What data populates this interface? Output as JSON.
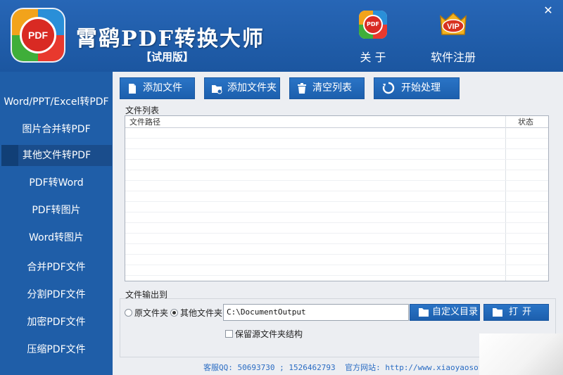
{
  "header": {
    "logo_text": "PDF",
    "title": "霄鹞PDF转换大师",
    "edition": "【试用版】",
    "about_label": "关 于",
    "about_icon_text": "PDF",
    "register_label": "软件注册",
    "register_icon_text": "VIP",
    "close_glyph": "✕"
  },
  "sidebar": {
    "items": [
      {
        "label": "Word/PPT/Excel转PDF"
      },
      {
        "label": "图片合并转PDF"
      },
      {
        "label": "其他文件转PDF"
      },
      {
        "label": "PDF转Word"
      },
      {
        "label": "PDF转图片"
      },
      {
        "label": "Word转图片"
      },
      {
        "label": "合并PDF文件"
      },
      {
        "label": "分割PDF文件"
      },
      {
        "label": "加密PDF文件"
      },
      {
        "label": "压缩PDF文件"
      }
    ],
    "active_index": 2
  },
  "toolbar": {
    "add_file": "添加文件",
    "add_folder": "添加文件夹",
    "clear_list": "清空列表",
    "start": "开始处理"
  },
  "file_list": {
    "label": "文件列表",
    "columns": [
      "文件路径",
      "状态"
    ],
    "rows": []
  },
  "output": {
    "label": "文件输出到",
    "radio_source": "原文件夹",
    "radio_other": "其他文件夹",
    "selected": "other",
    "path": "C:\\DocumentOutput",
    "custom_dir_button": "自定义目录",
    "open_button": "打开",
    "keep_structure": "保留源文件夹结构",
    "keep_structure_checked": false
  },
  "footer": {
    "qq": "客服QQ: 50693730 ; 1526462793",
    "website": "官方网站: http://www.xiaoyaosoft.cn"
  },
  "colors": {
    "brand_blue": "#1f5ea8",
    "button_blue": "#2a74c6",
    "panel_bg": "#eceef2",
    "footer_text": "#2a6cc3"
  }
}
